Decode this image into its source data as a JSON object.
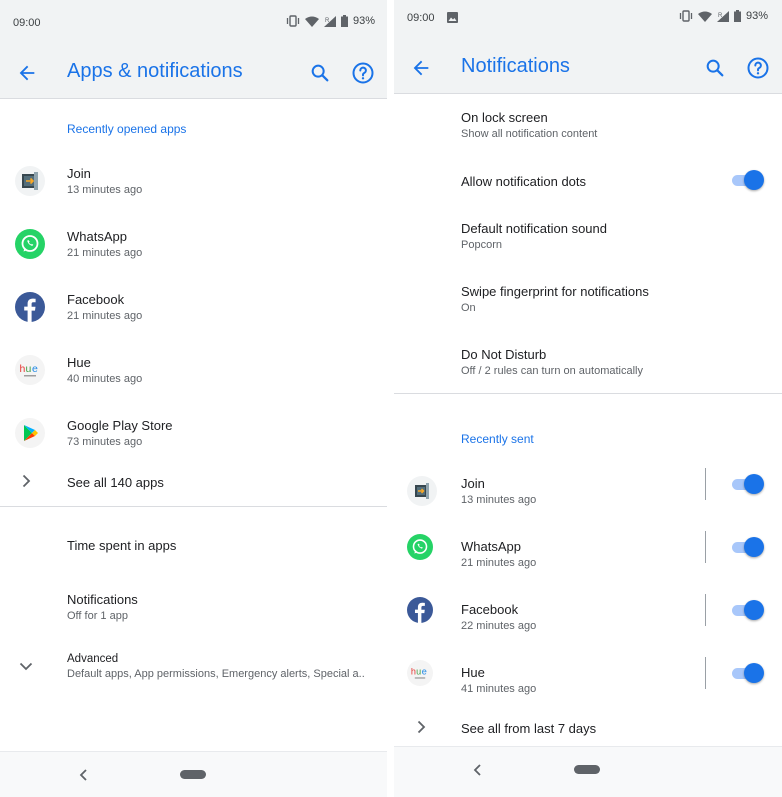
{
  "left": {
    "status": {
      "time": "09:00",
      "battery": "93%",
      "signal_label": "R"
    },
    "appbar": {
      "title": "Apps & notifications"
    },
    "section_recent": "Recently opened apps",
    "apps": [
      {
        "name": "Join",
        "sub": "13 minutes ago",
        "icon": "join-icon"
      },
      {
        "name": "WhatsApp",
        "sub": "21 minutes ago",
        "icon": "whatsapp-icon"
      },
      {
        "name": "Facebook",
        "sub": "21 minutes ago",
        "icon": "facebook-icon"
      },
      {
        "name": "Hue",
        "sub": "40 minutes ago",
        "icon": "hue-icon"
      },
      {
        "name": "Google Play Store",
        "sub": "73 minutes ago",
        "icon": "play-store-icon"
      }
    ],
    "see_all": "See all 140 apps",
    "time_spent": "Time spent in apps",
    "notifications": {
      "title": "Notifications",
      "sub": "Off for 1 app"
    },
    "advanced": {
      "title": "Advanced",
      "sub": "Default apps, App permissions, Emergency alerts, Special a.."
    }
  },
  "right": {
    "status": {
      "time": "09:00",
      "battery": "93%",
      "signal_label": "R"
    },
    "appbar": {
      "title": "Notifications"
    },
    "settings": [
      {
        "title": "On lock screen",
        "sub": "Show all notification content"
      },
      {
        "title": "Allow notification dots",
        "toggle": true
      },
      {
        "title": "Default notification sound",
        "sub": "Popcorn"
      },
      {
        "title": "Swipe fingerprint for notifications",
        "sub": "On"
      },
      {
        "title": "Do Not Disturb",
        "sub": "Off / 2 rules can turn on automatically"
      }
    ],
    "section_recent": "Recently sent",
    "recent": [
      {
        "name": "Join",
        "sub": "13 minutes ago",
        "icon": "join-icon",
        "enabled": true
      },
      {
        "name": "WhatsApp",
        "sub": "21 minutes ago",
        "icon": "whatsapp-icon",
        "enabled": true
      },
      {
        "name": "Facebook",
        "sub": "22 minutes ago",
        "icon": "facebook-icon",
        "enabled": true
      },
      {
        "name": "Hue",
        "sub": "41 minutes ago",
        "icon": "hue-icon",
        "enabled": true
      }
    ],
    "see_all": "See all from last 7 days"
  },
  "colors": {
    "accent": "#1a73e8",
    "toggle_track": "#a8c7fa",
    "whatsapp": "#25d366",
    "facebook": "#3b5998",
    "bar_bg": "#f1f3f4"
  }
}
